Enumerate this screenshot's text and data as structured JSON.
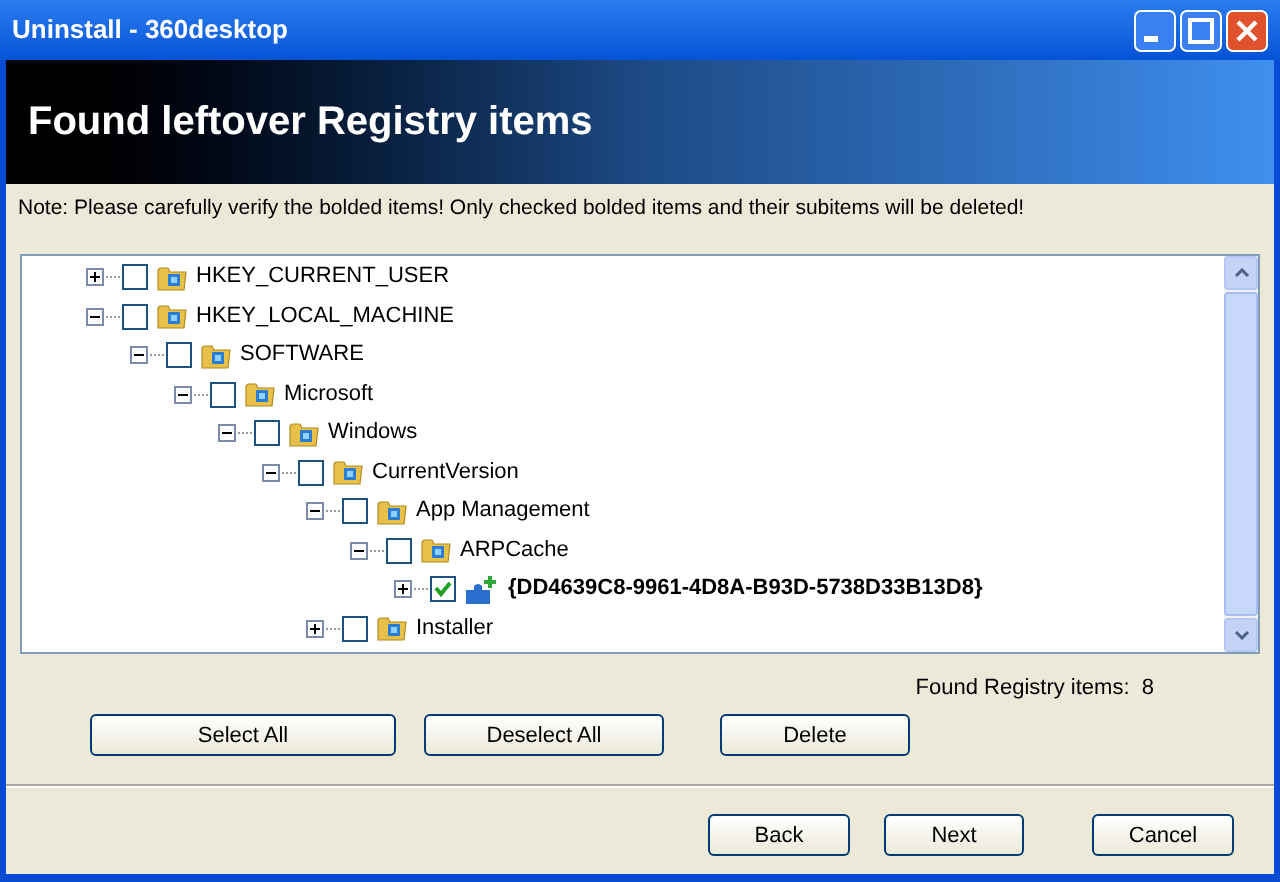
{
  "window": {
    "title": "Uninstall - 360desktop"
  },
  "header": {
    "title": "Found leftover Registry items"
  },
  "note": "Note: Please carefully verify the bolded items! Only checked bolded items and their subitems will be deleted!",
  "tree": [
    {
      "label": "HKEY_CURRENT_USER",
      "kind": "folder",
      "expanded": false,
      "checked": false,
      "bold": false
    },
    {
      "label": "HKEY_LOCAL_MACHINE",
      "kind": "folder",
      "expanded": true,
      "checked": false,
      "bold": false,
      "children": [
        {
          "label": "SOFTWARE",
          "kind": "folder",
          "expanded": true,
          "checked": false,
          "bold": false,
          "children": [
            {
              "label": "Microsoft",
              "kind": "folder",
              "expanded": true,
              "checked": false,
              "bold": false,
              "children": [
                {
                  "label": "Windows",
                  "kind": "folder",
                  "expanded": true,
                  "checked": false,
                  "bold": false,
                  "children": [
                    {
                      "label": "CurrentVersion",
                      "kind": "folder",
                      "expanded": true,
                      "checked": false,
                      "bold": false,
                      "children": [
                        {
                          "label": "App Management",
                          "kind": "folder",
                          "expanded": true,
                          "checked": false,
                          "bold": false,
                          "children": [
                            {
                              "label": "ARPCache",
                              "kind": "folder",
                              "expanded": true,
                              "checked": false,
                              "bold": false,
                              "children": [
                                {
                                  "label": "{DD4639C8-9961-4D8A-B93D-5738D33B13D8}",
                                  "kind": "leftover",
                                  "expanded": false,
                                  "checked": true,
                                  "bold": true
                                }
                              ]
                            }
                          ]
                        },
                        {
                          "label": "Installer",
                          "kind": "folder",
                          "expanded": false,
                          "checked": false,
                          "bold": false
                        }
                      ]
                    }
                  ]
                }
              ]
            }
          ]
        }
      ]
    }
  ],
  "found_count": "Found Registry items:  8",
  "action_buttons": [
    "Select All",
    "Deselect All",
    "Delete"
  ],
  "nav_buttons": [
    "Back",
    "Next",
    "Cancel"
  ]
}
